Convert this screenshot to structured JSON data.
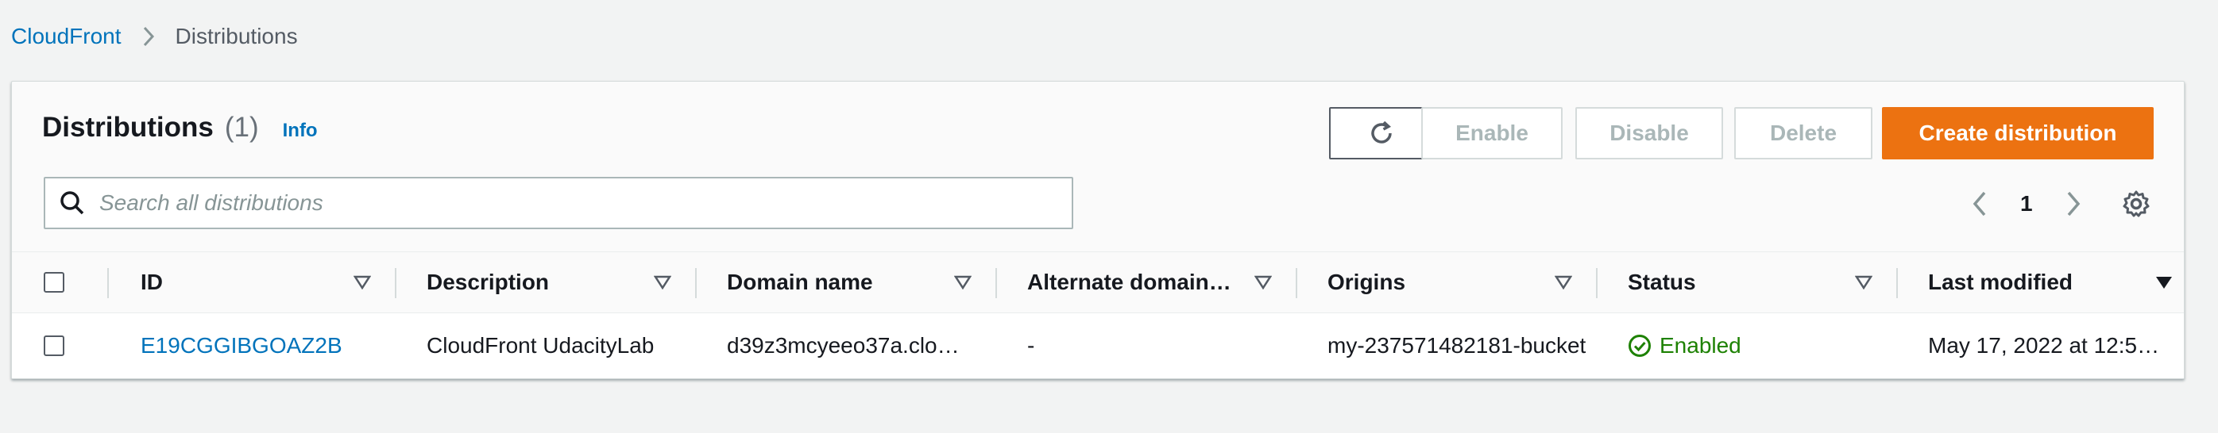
{
  "breadcrumb": {
    "items": [
      "CloudFront",
      "Distributions"
    ]
  },
  "header": {
    "title": "Distributions",
    "count": "(1)",
    "info": "Info"
  },
  "toolbar": {
    "enable": "Enable",
    "disable": "Disable",
    "delete": "Delete",
    "create": "Create distribution"
  },
  "search": {
    "placeholder": "Search all distributions",
    "value": ""
  },
  "pagination": {
    "current_page": "1"
  },
  "table": {
    "columns": [
      "ID",
      "Description",
      "Domain name",
      "Alternate domain…",
      "Origins",
      "Status",
      "Last modified"
    ],
    "rows": [
      {
        "id": "E19CGGIBGOAZ2B",
        "description": "CloudFront UdacityLab",
        "domain": "d39z3mcyeeo37a.clo…",
        "alternate": "-",
        "origins": "my-237571482181-bucket",
        "status": "Enabled",
        "last_modified": "May 17, 2022 at 12:5…"
      }
    ]
  },
  "colors": {
    "accent": "#0073bb",
    "primary_button": "#ec7211",
    "success": "#1d8102"
  }
}
